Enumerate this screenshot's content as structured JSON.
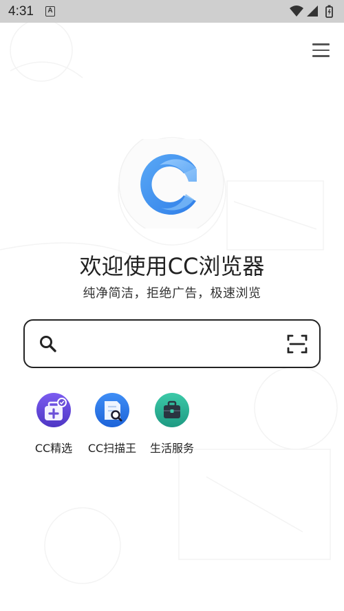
{
  "status_bar": {
    "time": "4:31",
    "notification_glyph": "A",
    "icons": [
      "wifi-icon",
      "signal-icon",
      "battery-icon"
    ]
  },
  "header": {
    "menu_icon": "hamburger-menu-icon"
  },
  "logo": {
    "name": "cc-browser-logo-icon",
    "accent_color": "#3b8ff0"
  },
  "welcome": {
    "title": "欢迎使用CC浏览器",
    "subtitle": "纯净简洁，拒绝广告，极速浏览"
  },
  "search": {
    "value": "",
    "placeholder": "",
    "search_icon": "search-icon",
    "scan_icon": "scan-icon"
  },
  "shortcuts": [
    {
      "label": "CC精选",
      "icon": "cc-featured-icon",
      "color": "#6b4fd8"
    },
    {
      "label": "CC扫描王",
      "icon": "cc-scanner-icon",
      "color": "#2f7ff0"
    },
    {
      "label": "生活服务",
      "icon": "life-service-icon",
      "color": "#2fb39a"
    }
  ]
}
